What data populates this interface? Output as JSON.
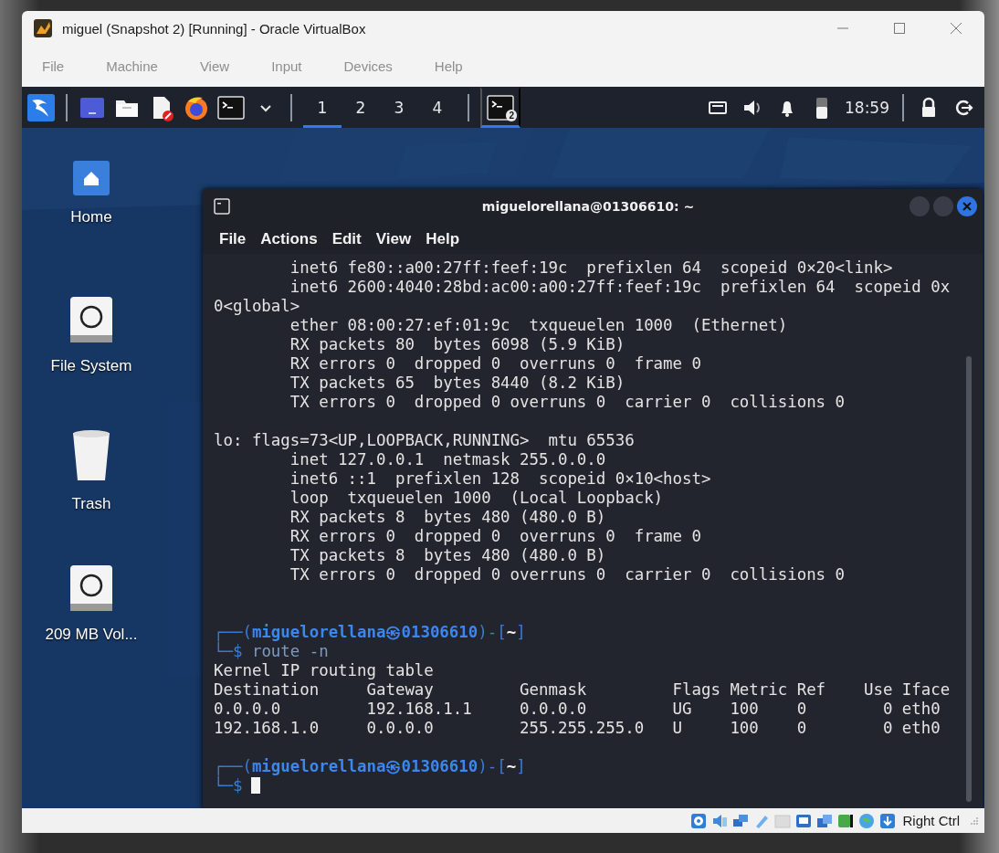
{
  "window": {
    "title": "miguel (Snapshot 2) [Running] - Oracle VirtualBox"
  },
  "menu": [
    "File",
    "Machine",
    "View",
    "Input",
    "Devices",
    "Help"
  ],
  "panel": {
    "workspaces": [
      {
        "label": "1",
        "selected": true
      },
      {
        "label": "2",
        "selected": false
      },
      {
        "label": "3",
        "selected": false
      },
      {
        "label": "4",
        "selected": false
      }
    ],
    "task": {
      "badge": "2",
      "selected": true
    },
    "clock": "18:59"
  },
  "desktop_icons": [
    {
      "label": "Home",
      "kind": "home"
    },
    {
      "label": "File System",
      "kind": "drive"
    },
    {
      "label": "Trash",
      "kind": "trash"
    },
    {
      "label": "209 MB Vol...",
      "kind": "drive"
    }
  ],
  "terminal": {
    "title": "miguelorellana@01306610: ~",
    "menu": [
      "File",
      "Actions",
      "Edit",
      "View",
      "Help"
    ],
    "lines": [
      {
        "kind": "output",
        "text": "        inet6 fe80::a00:27ff:feef:19c  prefixlen 64  scopeid 0×20<link>"
      },
      {
        "kind": "output",
        "text": "        inet6 2600:4040:28bd:ac00:a00:27ff:feef:19c  prefixlen 64  scopeid 0x"
      },
      {
        "kind": "output",
        "text": "0<global>"
      },
      {
        "kind": "output",
        "text": "        ether 08:00:27:ef:01:9c  txqueuelen 1000  (Ethernet)"
      },
      {
        "kind": "output",
        "text": "        RX packets 80  bytes 6098 (5.9 KiB)"
      },
      {
        "kind": "output",
        "text": "        RX errors 0  dropped 0  overruns 0  frame 0"
      },
      {
        "kind": "output",
        "text": "        TX packets 65  bytes 8440 (8.2 KiB)"
      },
      {
        "kind": "output",
        "text": "        TX errors 0  dropped 0 overruns 0  carrier 0  collisions 0"
      },
      {
        "kind": "blank"
      },
      {
        "kind": "output",
        "text": "lo: flags=73<UP,LOOPBACK,RUNNING>  mtu 65536"
      },
      {
        "kind": "output",
        "text": "        inet 127.0.0.1  netmask 255.0.0.0"
      },
      {
        "kind": "output",
        "text": "        inet6 ::1  prefixlen 128  scopeid 0×10<host>"
      },
      {
        "kind": "output",
        "text": "        loop  txqueuelen 1000  (Local Loopback)"
      },
      {
        "kind": "output",
        "text": "        RX packets 8  bytes 480 (480.0 B)"
      },
      {
        "kind": "output",
        "text": "        RX errors 0  dropped 0  overruns 0  frame 0"
      },
      {
        "kind": "output",
        "text": "        TX packets 8  bytes 480 (480.0 B)"
      },
      {
        "kind": "output",
        "text": "        TX errors 0  dropped 0 overruns 0  carrier 0  collisions 0"
      },
      {
        "kind": "blank"
      },
      {
        "kind": "blank"
      },
      {
        "kind": "prompt",
        "open": "┌──(",
        "user": "miguelorellana㉿01306610",
        "mid": ")-[",
        "dir": "~",
        "close": "]"
      },
      {
        "kind": "command",
        "frame": "└─$",
        "command": "route -n"
      },
      {
        "kind": "output",
        "text": "Kernel IP routing table"
      },
      {
        "kind": "output",
        "text": "Destination     Gateway         Genmask         Flags Metric Ref    Use Iface"
      },
      {
        "kind": "output",
        "text": "0.0.0.0         192.168.1.1     0.0.0.0         UG    100    0        0 eth0"
      },
      {
        "kind": "output",
        "text": "192.168.1.0     0.0.0.0         255.255.255.0   U     100    0        0 eth0"
      },
      {
        "kind": "blank"
      },
      {
        "kind": "prompt",
        "open": "┌──(",
        "user": "miguelorellana㉿01306610",
        "mid": ")-[",
        "dir": "~",
        "close": "]"
      },
      {
        "kind": "command",
        "frame": "└─$",
        "cursor": true
      }
    ]
  },
  "status_bar": {
    "host_key": "Right Ctrl"
  }
}
